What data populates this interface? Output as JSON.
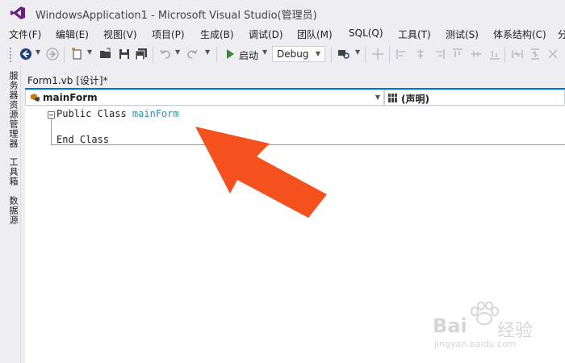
{
  "window": {
    "title": "WindowsApplication1 - Microsoft Visual Studio(管理员)"
  },
  "menu": [
    {
      "label": "文件(F)"
    },
    {
      "label": "编辑(E)"
    },
    {
      "label": "视图(V)"
    },
    {
      "label": "项目(P)"
    },
    {
      "label": "生成(B)"
    },
    {
      "label": "调试(D)"
    },
    {
      "label": "团队(M)"
    },
    {
      "label": "SQL(Q)"
    },
    {
      "label": "工具(T)"
    },
    {
      "label": "测试(S)"
    },
    {
      "label": "体系结构(C)"
    },
    {
      "label": "分"
    }
  ],
  "toolbar": {
    "start_label": "启动",
    "configuration": "Debug"
  },
  "side_tabs": [
    {
      "label": "服务器资源管理器"
    },
    {
      "label": "工具箱"
    },
    {
      "label": "数据源"
    }
  ],
  "document_tab": {
    "label": "Form1.vb [设计]*"
  },
  "navigation": {
    "class_selector": "mainForm",
    "member_selector": "(声明)"
  },
  "code": {
    "line1_keywords": "Public Class ",
    "line1_name": "mainForm",
    "line3": "End Class"
  },
  "watermark": {
    "brand": "Bai",
    "brand_cn": "经验",
    "url": "jingyan.baidu.com"
  },
  "colors": {
    "accent": "#007acc",
    "arrow": "#f4511e",
    "identifier": "#2b91af"
  },
  "icons": [
    "vs-logo-icon",
    "back-icon",
    "forward-icon",
    "new-project-icon",
    "open-icon",
    "save-icon",
    "save-all-icon",
    "undo-icon",
    "redo-icon",
    "start-icon",
    "class-icon",
    "members-icon"
  ]
}
